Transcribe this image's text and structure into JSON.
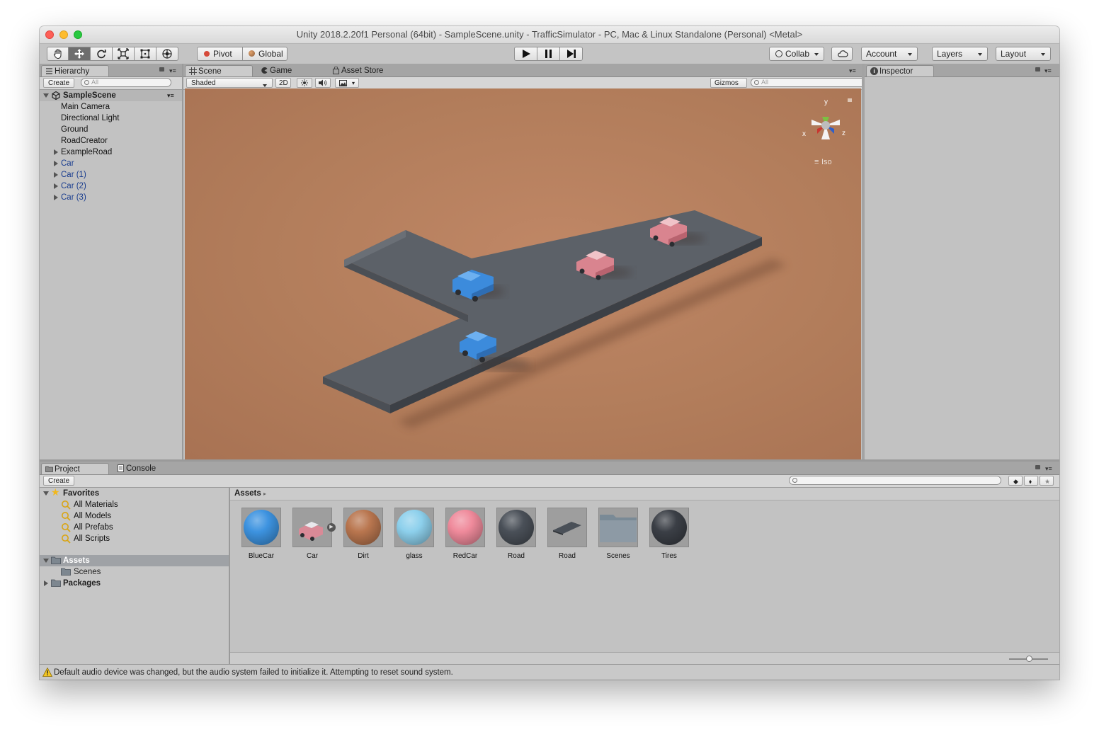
{
  "window": {
    "title": "Unity 2018.2.20f1 Personal (64bit) - SampleScene.unity - TrafficSimulator - PC, Mac & Linux Standalone (Personal) <Metal>"
  },
  "toolbar": {
    "tools": [
      "hand-tool",
      "move-tool",
      "rotate-tool",
      "scale-tool",
      "rect-tool",
      "transform-tool"
    ],
    "active_tool": "move-tool",
    "pivot_label": "Pivot",
    "global_label": "Global",
    "collab_label": "Collab",
    "account_label": "Account",
    "layers_label": "Layers",
    "layout_label": "Layout"
  },
  "hierarchy": {
    "tab_label": "Hierarchy",
    "create_label": "Create",
    "search_placeholder": "All",
    "scene_name": "SampleScene",
    "items": [
      {
        "label": "Main Camera",
        "prefab": false,
        "expandable": false
      },
      {
        "label": "Directional Light",
        "prefab": false,
        "expandable": false
      },
      {
        "label": "Ground",
        "prefab": false,
        "expandable": false
      },
      {
        "label": "RoadCreator",
        "prefab": false,
        "expandable": false
      },
      {
        "label": "ExampleRoad",
        "prefab": false,
        "expandable": true
      },
      {
        "label": "Car",
        "prefab": true,
        "expandable": true
      },
      {
        "label": "Car (1)",
        "prefab": true,
        "expandable": true
      },
      {
        "label": "Car (2)",
        "prefab": true,
        "expandable": true
      },
      {
        "label": "Car (3)",
        "prefab": true,
        "expandable": true
      }
    ]
  },
  "scene_view": {
    "tabs": [
      {
        "label": "Scene",
        "active": true
      },
      {
        "label": "Game",
        "active": false
      },
      {
        "label": "Asset Store",
        "active": false
      }
    ],
    "draw_mode": "Shaded",
    "mode_2d_label": "2D",
    "gizmos_label": "Gizmos",
    "search_placeholder": "All",
    "gizmo_axes": {
      "y": "y",
      "x": "x",
      "z": "z"
    },
    "projection_label": "Iso"
  },
  "inspector": {
    "tab_label": "Inspector"
  },
  "bottom_tabs": [
    {
      "label": "Project",
      "active": true
    },
    {
      "label": "Console",
      "active": false
    }
  ],
  "project": {
    "create_label": "Create",
    "favorites_label": "Favorites",
    "favorites": [
      "All Materials",
      "All Models",
      "All Prefabs",
      "All Scripts"
    ],
    "assets_folder": "Assets",
    "assets_children": [
      "Scenes"
    ],
    "packages_label": "Packages",
    "breadcrumb": "Assets",
    "assets": [
      {
        "label": "BlueCar",
        "kind": "material",
        "color": "#3d93e0"
      },
      {
        "label": "Car",
        "kind": "model",
        "color": "#d98a97"
      },
      {
        "label": "Dirt",
        "kind": "material",
        "color": "#b9764f"
      },
      {
        "label": "glass",
        "kind": "material",
        "color": "#8dd0ec"
      },
      {
        "label": "RedCar",
        "kind": "material",
        "color": "#ef8a9b"
      },
      {
        "label": "Road",
        "kind": "material",
        "color": "#4a5058"
      },
      {
        "label": "Road",
        "kind": "mesh",
        "color": "#4a5058"
      },
      {
        "label": "Scenes",
        "kind": "folder",
        "color": "#7a8a96"
      },
      {
        "label": "Tires",
        "kind": "material",
        "color": "#3b3f46"
      }
    ]
  },
  "status": {
    "message": "Default audio device was changed, but the audio system failed to initialize it. Attempting to reset sound system."
  }
}
